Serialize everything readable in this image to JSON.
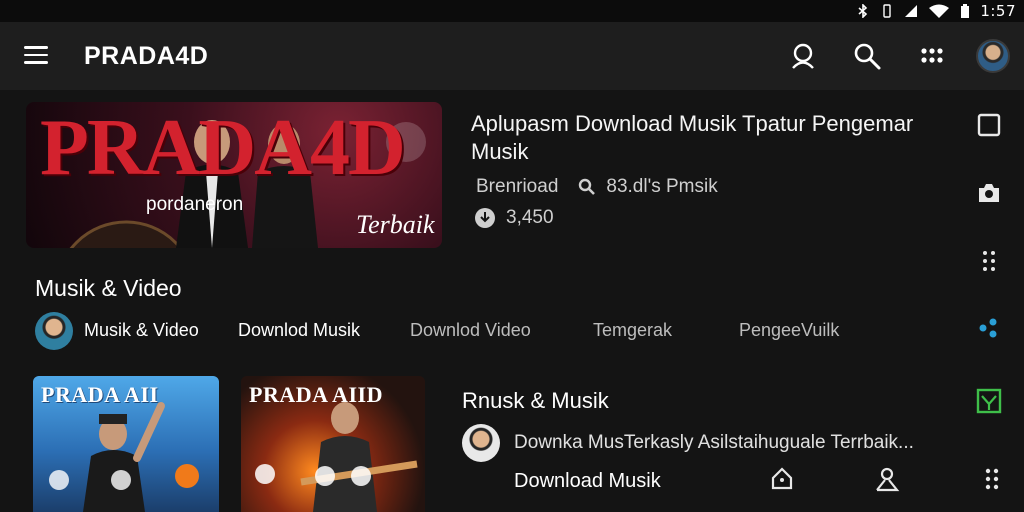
{
  "status_bar": {
    "time": "1:57",
    "icons": [
      "bluetooth-icon",
      "vibrate-icon",
      "signal-icon",
      "wifi-icon",
      "battery-icon"
    ]
  },
  "app_bar": {
    "title": "PRADA4D",
    "icons": [
      "menu-icon",
      "profile-search-icon",
      "search-icon",
      "apps-grid-icon",
      "avatar"
    ]
  },
  "featured": {
    "banner_text": "PRADA4D",
    "banner_caption": "pordaneron",
    "banner_script": "Terbaik",
    "title": "Aplupasm Download Musik Tpatur Pengemar Musik",
    "meta_source": "Brenrioad",
    "meta_stats": "83.dl's Pmsik",
    "downloads": "3,450"
  },
  "section": {
    "title": "Musik & Video"
  },
  "chips": [
    {
      "label": "Musik & Video"
    },
    {
      "label": "Downlod Musik"
    },
    {
      "label": "Downlod Video"
    },
    {
      "label": "Temgerak"
    },
    {
      "label": "PengeeVuilk"
    }
  ],
  "thumbnails": [
    {
      "label": "PRADA AII"
    },
    {
      "label": "PRADA AIID"
    }
  ],
  "card": {
    "title": "Rnusk & Musik",
    "description": "Downka MusTerkasly Asilstaihuguale Terrbaik...",
    "download_label": "Download Musik"
  },
  "colors": {
    "background": "#141414",
    "app_bar": "#1e1e1e",
    "brand_red": "#d3222e",
    "accent_blue": "#2a9fd6",
    "accent_green": "#3fbf4a"
  }
}
